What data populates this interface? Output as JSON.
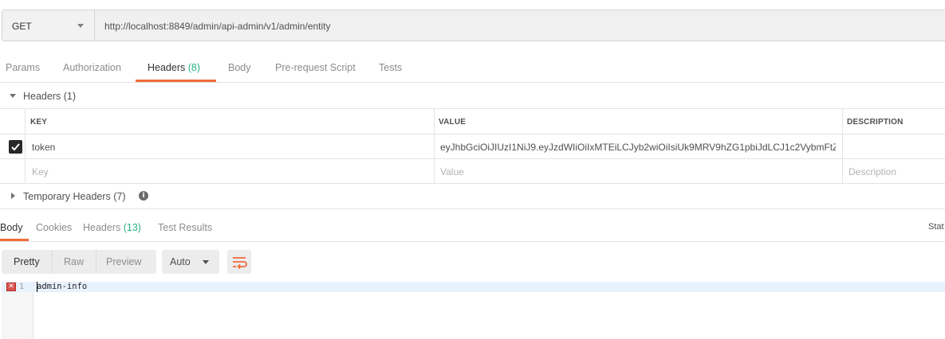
{
  "request": {
    "method": "GET",
    "url": "http://localhost:8849/admin/api-admin/v1/admin/entity"
  },
  "req_tabs": [
    {
      "label": "Params"
    },
    {
      "label": "Authorization"
    },
    {
      "label": "Headers",
      "count": "(8)"
    },
    {
      "label": "Body"
    },
    {
      "label": "Pre-request Script"
    },
    {
      "label": "Tests"
    }
  ],
  "headers_section": {
    "title": "Headers (1)",
    "columns": {
      "key": "KEY",
      "value": "VALUE",
      "description": "DESCRIPTION"
    },
    "rows": [
      {
        "checked": true,
        "key": "token",
        "value": "eyJhbGciOiJIUzI1NiJ9.eyJzdWIiOiIxMTEiLCJyb2wiOiIsiUk9MRV9hZG1pbiJdLCJ1c2VybmFtZ...",
        "description": ""
      }
    ],
    "placeholders": {
      "key": "Key",
      "value": "Value",
      "description": "Description"
    }
  },
  "temp_headers": {
    "title": "Temporary Headers (7)"
  },
  "resp_tabs": [
    {
      "label": "Body"
    },
    {
      "label": "Cookies"
    },
    {
      "label": "Headers",
      "count": "(13)"
    },
    {
      "label": "Test Results"
    }
  ],
  "status_label": "Stat",
  "view_modes": [
    "Pretty",
    "Raw",
    "Preview"
  ],
  "format": "Auto",
  "editor": {
    "line_number": "1",
    "error_marker": "✕",
    "code": "admin-info"
  },
  "colors": {
    "accent": "#f26b3a",
    "count": "#26b47f"
  }
}
